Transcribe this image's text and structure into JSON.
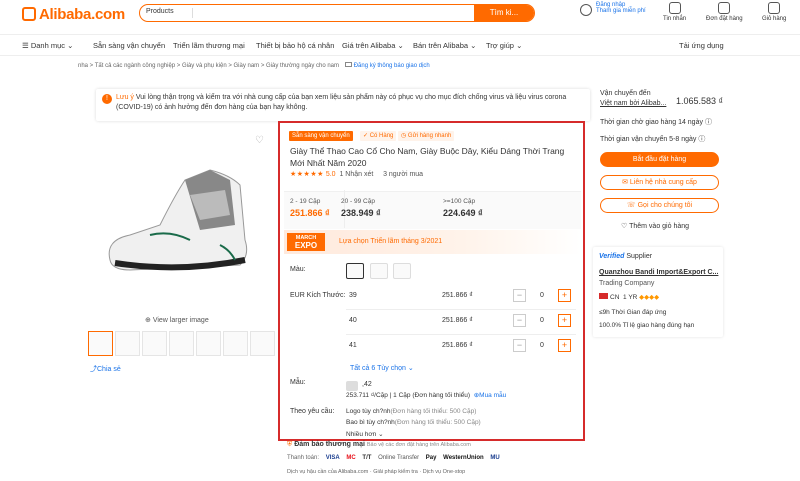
{
  "header": {
    "logo": "Alibaba.com",
    "search_category": "Products",
    "search_placeholder": "",
    "search_button": "Tìm ki...",
    "account": {
      "line1": "Đăng nhập",
      "line2": "Tham gia miễn phí"
    },
    "messages": "Tin nhắn",
    "orders": "Đơn đặt hàng",
    "cart": "Giỏ hàng"
  },
  "nav": {
    "categories": "Danh mục",
    "items": [
      "Sẵn sàng vận chuyển",
      "Triển lãm thương mại",
      "Thiết bị bảo hộ cá nhân",
      "Giá trên Alibaba",
      "Bán trên Alibaba",
      "Trợ giúp"
    ],
    "app": "Tải ứng dụng"
  },
  "breadcrumb": {
    "path": "nha > Tất cả các ngành công nghiệp > Giày và phụ kiện > Giày nam > Giày thường ngày cho nam",
    "subscribe": "Đăng ký thông báo giao dịch"
  },
  "notice": {
    "prefix": "Lưu ý",
    "text": "Vui lòng thận trọng và kiểm tra với nhà cung cấp của bạn xem liệu sản phẩm này có phục vụ cho mục đích chống virus và liệu virus corona (COVID-19) có ảnh hưởng đến đơn hàng của bạn hay không."
  },
  "gallery": {
    "view_larger": "View larger image",
    "share": "Chia sẻ",
    "thumbnail_count": 7
  },
  "product": {
    "tags": {
      "ready": "Sẵn sàng vận chuyển",
      "in_stock": "Có Hàng",
      "fast": "Gửi hàng nhanh"
    },
    "title": "Giày Thể Thao Cao Cổ Cho Nam, Giày Buộc Dây, Kiểu Dáng Thời Trang Mới Nhất Năm 2020",
    "rating": 5.0,
    "rating_text": "5.0",
    "reviews": "1 Nhận xét",
    "buyers": "3 người mua",
    "prices": [
      {
        "tier": "2 - 19 Cặp",
        "price": "251.866 ₫"
      },
      {
        "tier": "20 - 99 Cặp",
        "price": "238.949 ₫"
      },
      {
        "tier": ">=100 Cặp",
        "price": "224.649 ₫"
      }
    ],
    "expo_badge_line1": "MARCH",
    "expo_badge_line2": "EXPO",
    "expo_text": "Lựa chọn Triển lãm tháng 3/2021",
    "color_label": "Màu:",
    "size_label": "EUR Kích Thước:",
    "sizes": [
      {
        "size": "39",
        "price": "251.866 ₫",
        "qty": "0"
      },
      {
        "size": "40",
        "price": "251.866 ₫",
        "qty": "0"
      },
      {
        "size": "41",
        "price": "251.866 ₫",
        "qty": "0"
      }
    ],
    "all_options": "Tất cả 6 Tùy chọn",
    "sample_label": "Mẫu:",
    "sample_count": ",42",
    "sample_price": "253.711 ₫/Cặp | 1 Cặp (Đơn hàng tối thiểu)",
    "sample_buy": "Mua mẫu",
    "custom_label": "Theo yêu cầu:",
    "custom_logo": "Logo tùy ch?nh",
    "custom_logo_min": "(Đơn hàng tối thiểu: 500 Cặp)",
    "custom_pack": "Bao bì tùy ch?nh",
    "custom_pack_min": "(Đơn hàng tối thiểu: 500 Cặp)",
    "more": "Nhiều hơn"
  },
  "footer_panel": {
    "guarantee": "Đảm bảo thương mại",
    "guarantee_sub": "Bảo vệ các đơn đặt hàng trên Alibaba.com",
    "payment_label": "Thanh toán:",
    "payment_methods": [
      "VISA",
      "MC",
      "T/T",
      "Online Transfer",
      "Pay",
      "WesternUnion",
      "MU"
    ],
    "services": "Dịch vụ hậu cần của Alibaba.com  ·  Giải pháp kiểm tra  ·  Dịch vụ One-stop"
  },
  "shipping": {
    "to_label": "Vận chuyển đến",
    "to_country": "Việt nam bởi Alibab...",
    "cost": "1.065.583 ₫",
    "lead_time": "Thời gian chờ giao hàng 14 ngày",
    "transit_time": "Thời gian vận chuyển 5-8 ngày",
    "start_order": "Bắt đầu đặt hàng",
    "contact": "Liên hệ nhà cung cấp",
    "call": "Gọi cho chúng tôi",
    "add_fav": "Thêm vào giỏ hàng"
  },
  "supplier": {
    "verified": "Verified",
    "label": "Supplier",
    "name": "Quanzhou Bandi Import&Export C...",
    "type": "Trading Company",
    "country": "CN",
    "years": "1 YR",
    "response_time": "≤9h Thời Gian đáp ứng",
    "on_time": "100.0% Tỉ lệ giao hàng đúng hạn"
  },
  "colors": {
    "accent": "#ff6a00",
    "highlight_border": "#d62b2b",
    "link": "#1a73e8"
  }
}
